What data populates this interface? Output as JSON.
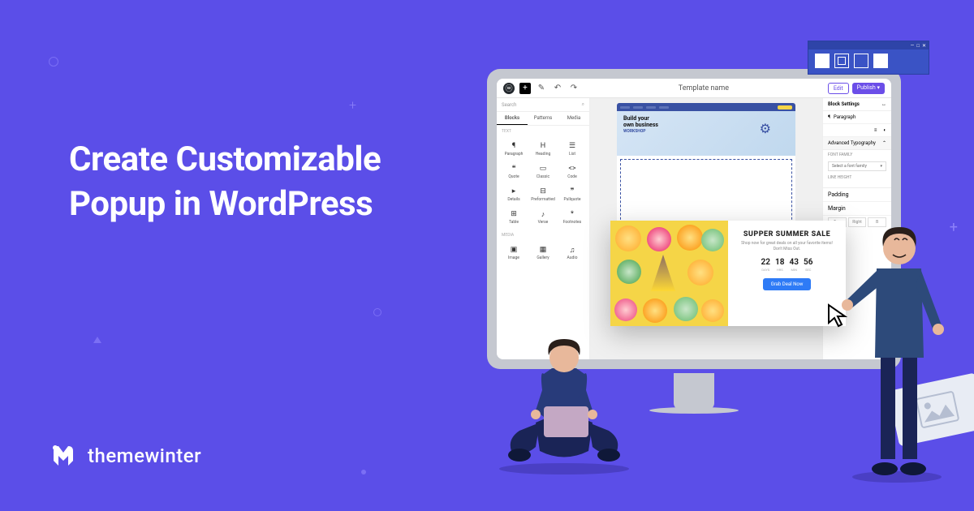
{
  "headline_l1": "Create Customizable",
  "headline_l2": "Popup in WordPress",
  "brand": "themewinter",
  "editor": {
    "title": "Template name",
    "edit": "Edit",
    "publish": "Publish",
    "search": "Search",
    "tabs": [
      "Blocks",
      "Patterns",
      "Media"
    ],
    "sec1": "TEXT",
    "sec2": "MEDIA",
    "blocks": [
      "Paragraph",
      "Heading",
      "List",
      "Quote",
      "Classic",
      "Code",
      "Details",
      "Preformatted",
      "Pullquote",
      "Table",
      "Verse",
      "Footnotes"
    ],
    "blocks2": [
      "Image",
      "Gallery",
      "Audio"
    ],
    "settings": {
      "title": "Block Settings",
      "paragraph": "Paragraph",
      "typography": "Advanced Typography",
      "font_family": "FONT FAMILY",
      "font_select": "Select a font family",
      "line_height": "LINE HEIGHT",
      "padding": "Padding",
      "margin": "Margin",
      "sides": [
        "Top",
        "Right",
        "B"
      ]
    }
  },
  "hero": {
    "title1": "Build your",
    "title2": "own business",
    "sub": "WORKSHOP"
  },
  "popup": {
    "title": "SUPPER SUMMER SALE",
    "sub": "Shop now for great deals on all your favorite items! Don't Miss Out.",
    "cta": "Grab Deal Now",
    "cd": [
      {
        "n": "22",
        "l": "DAYS"
      },
      {
        "n": "18",
        "l": "HRS"
      },
      {
        "n": "43",
        "l": "MIN"
      },
      {
        "n": "56",
        "l": "SEC"
      }
    ]
  }
}
